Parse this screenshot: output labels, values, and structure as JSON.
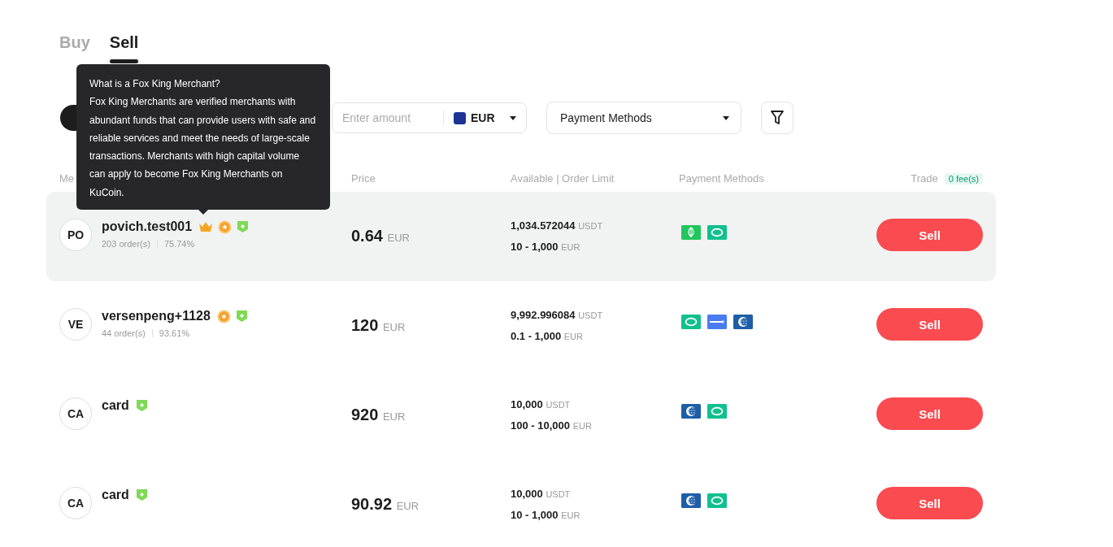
{
  "tabs": [
    {
      "label": "Buy",
      "selected": false
    },
    {
      "label": "Sell",
      "selected": true
    }
  ],
  "filters": {
    "amount": {
      "placeholder": "Enter amount",
      "currency": "EUR"
    },
    "payment": {
      "value": "Payment Methods"
    }
  },
  "table": {
    "columns": [
      "Me",
      "Price",
      "Available | Order Limit",
      "Payment Methods",
      "Trade"
    ],
    "fee_badge": "0 fee(s)",
    "rows": [
      {
        "initials": "PO",
        "name": "povich.test001",
        "badges": [
          {
            "kind": "crown"
          },
          {
            "kind": "medal"
          },
          {
            "kind": "shield"
          }
        ],
        "orders": "203 order(s)",
        "rate": "75.74%",
        "price": "0.64",
        "price_unit": "EUR",
        "available": "1,034.572044",
        "available_unit": "USDT",
        "limit": "10 - 1,000",
        "limit_unit": "EUR",
        "payments": [
          {
            "kind": "leaf"
          },
          {
            "kind": "chat"
          }
        ],
        "action": "Sell",
        "selected": true
      },
      {
        "initials": "VE",
        "name": "versenpeng+1128",
        "badges": [
          {
            "kind": "medal"
          },
          {
            "kind": "shield"
          }
        ],
        "orders": "44 order(s)",
        "rate": "93.61%",
        "price": "120",
        "price_unit": "EUR",
        "available": "9,992.996084",
        "available_unit": "USDT",
        "limit": "0.1 - 1,000",
        "limit_unit": "EUR",
        "payments": [
          {
            "kind": "chat"
          },
          {
            "kind": "alipay"
          },
          {
            "kind": "globe"
          }
        ],
        "action": "Sell",
        "selected": false
      },
      {
        "initials": "CA",
        "name": "card",
        "badges": [
          {
            "kind": "shield"
          }
        ],
        "price": "920",
        "price_unit": "EUR",
        "available": "10,000",
        "available_unit": "USDT",
        "limit": "100 - 10,000",
        "limit_unit": "EUR",
        "payments": [
          {
            "kind": "globe"
          },
          {
            "kind": "chat"
          }
        ],
        "action": "Sell",
        "selected": false
      },
      {
        "initials": "CA",
        "name": "card",
        "badges": [
          {
            "kind": "shield"
          }
        ],
        "price": "90.92",
        "price_unit": "EUR",
        "available": "10,000",
        "available_unit": "USDT",
        "limit": "10 - 1,000",
        "limit_unit": "EUR",
        "payments": [
          {
            "kind": "globe"
          },
          {
            "kind": "chat"
          }
        ],
        "action": "Sell",
        "selected": false
      }
    ]
  },
  "tooltip": {
    "title": "What is a Fox King Merchant?",
    "body": "Fox King Merchants are verified merchants with abundant funds that can provide users with safe and reliable services and meet the needs of large-scale transactions. Merchants with high capital volume can apply to become Fox King Merchants on KuCoin."
  }
}
